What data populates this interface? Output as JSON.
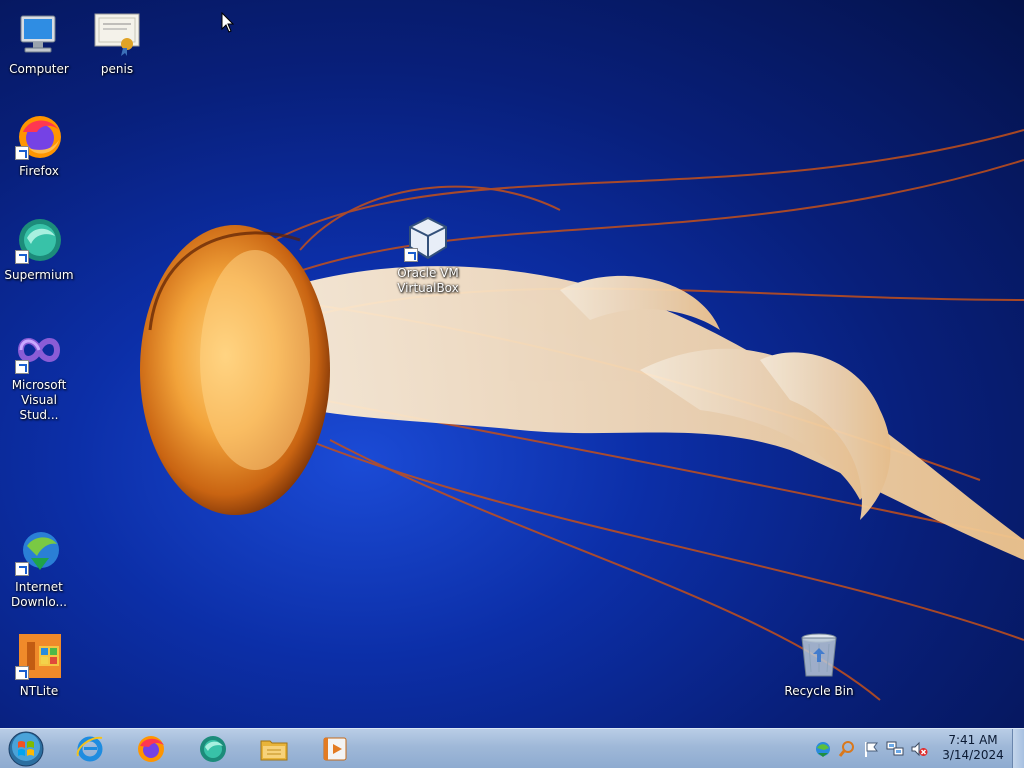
{
  "desktop": {
    "icons": [
      {
        "id": "computer",
        "label": "Computer",
        "icon": "computer-icon"
      },
      {
        "id": "penis",
        "label": "penis",
        "icon": "certificate-icon"
      },
      {
        "id": "firefox",
        "label": "Firefox",
        "icon": "firefox-icon"
      },
      {
        "id": "supermium",
        "label": "Supermium",
        "icon": "supermium-icon"
      },
      {
        "id": "visual-studio",
        "label": "Microsoft Visual Stud...",
        "icon": "visual-studio-icon"
      },
      {
        "id": "virtualbox",
        "label": "Oracle VM VirtualBox",
        "icon": "virtualbox-icon"
      },
      {
        "id": "idm",
        "label": "Internet Downlo...",
        "icon": "internet-download-manager-icon"
      },
      {
        "id": "ntlite",
        "label": "NTLite",
        "icon": "ntlite-icon"
      },
      {
        "id": "recycle-bin",
        "label": "Recycle Bin",
        "icon": "recycle-bin-icon"
      }
    ]
  },
  "taskbar": {
    "start": "start-orb-icon",
    "pinned": [
      {
        "name": "internet-explorer",
        "icon": "internet-explorer-icon"
      },
      {
        "name": "firefox",
        "icon": "firefox-icon"
      },
      {
        "name": "supermium",
        "icon": "supermium-icon"
      },
      {
        "name": "file-explorer",
        "icon": "folder-icon"
      },
      {
        "name": "media-player",
        "icon": "media-player-icon"
      }
    ],
    "tray": [
      {
        "name": "network-globe",
        "icon": "globe-arrow-icon"
      },
      {
        "name": "search",
        "icon": "magnifier-icon"
      },
      {
        "name": "action-center",
        "icon": "flag-icon"
      },
      {
        "name": "network",
        "icon": "network-icon"
      },
      {
        "name": "volume-muted",
        "icon": "speaker-muted-icon"
      }
    ],
    "clock": {
      "time": "7:41 AM",
      "date": "3/14/2024"
    }
  },
  "colors": {
    "wallpaper_dark": "#04124a",
    "wallpaper_blue": "#1b4bd6",
    "jellyfish_orange": "#e8861c",
    "taskbar": "#9fb8d8"
  }
}
